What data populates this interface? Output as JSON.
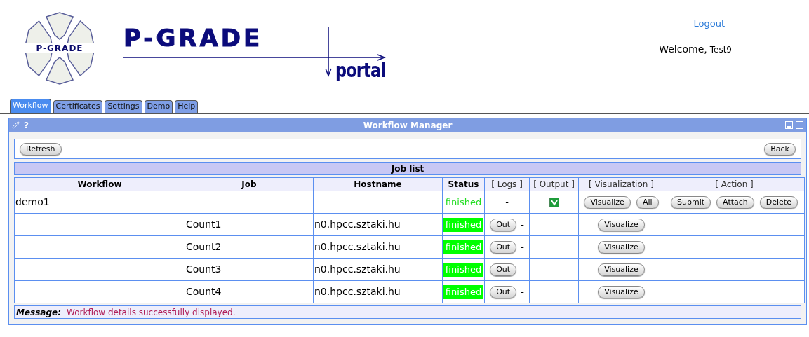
{
  "header": {
    "logo_text": "P-GRADE",
    "title": "P-GRADE",
    "subtitle": "portal",
    "logout": "Logout",
    "welcome": "Welcome,",
    "user": "Test9"
  },
  "tabs": [
    {
      "label": "Workflow",
      "selected": true
    },
    {
      "label": "Certificates",
      "selected": false
    },
    {
      "label": "Settings",
      "selected": false
    },
    {
      "label": "Demo",
      "selected": false
    },
    {
      "label": "Help",
      "selected": false
    }
  ],
  "panel": {
    "title": "Workflow Manager",
    "help": "?",
    "toolbar": {
      "left_button": "Refresh",
      "right_button": "Back"
    },
    "table": {
      "title": "Job list",
      "columns": [
        "Workflow",
        "Job",
        "Hostname",
        "Status",
        "[ Logs ]",
        "[ Output ]",
        "[ Visualization ]",
        "[ Action ]"
      ],
      "rows": [
        {
          "kind": "workflow",
          "workflow": "demo1",
          "status": "finished",
          "logs": "-",
          "output": {
            "checked": true
          },
          "visualization": [
            "Visualize",
            "All"
          ],
          "actions": [
            "Submit",
            "Attach",
            "Delete"
          ]
        },
        {
          "kind": "job",
          "job": "Count1",
          "hostname": "n0.hpcc.sztaki.hu",
          "status": "finished",
          "logs_button": "Out",
          "logs_suffix": "-",
          "visualization": [
            "Visualize"
          ]
        },
        {
          "kind": "job",
          "job": "Count2",
          "hostname": "n0.hpcc.sztaki.hu",
          "status": "finished",
          "logs_button": "Out",
          "logs_suffix": "-",
          "visualization": [
            "Visualize"
          ]
        },
        {
          "kind": "job",
          "job": "Count3",
          "hostname": "n0.hpcc.sztaki.hu",
          "status": "finished",
          "logs_button": "Out",
          "logs_suffix": "-",
          "visualization": [
            "Visualize"
          ]
        },
        {
          "kind": "job",
          "job": "Count4",
          "hostname": "n0.hpcc.sztaki.hu",
          "status": "finished",
          "logs_button": "Out",
          "logs_suffix": "-",
          "visualization": [
            "Visualize"
          ]
        }
      ]
    },
    "message": {
      "label": "Message:",
      "text": "Workflow details successfully displayed."
    }
  }
}
